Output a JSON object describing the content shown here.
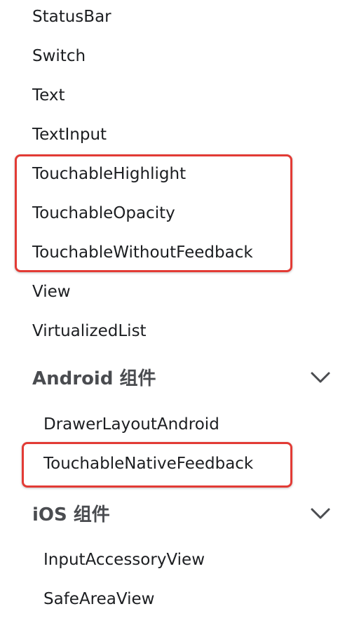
{
  "components": {
    "items": [
      "StatusBar",
      "Switch",
      "Text",
      "TextInput",
      "TouchableHighlight",
      "TouchableOpacity",
      "TouchableWithoutFeedback",
      "View",
      "VirtualizedList"
    ]
  },
  "android": {
    "title": "Android 组件",
    "items": [
      "DrawerLayoutAndroid",
      "TouchableNativeFeedback"
    ]
  },
  "ios": {
    "title": "iOS 组件",
    "items": [
      "InputAccessoryView",
      "SafeAreaView"
    ]
  },
  "highlight_color": "#e23b35",
  "chevron_icon": "chevron-down-icon"
}
